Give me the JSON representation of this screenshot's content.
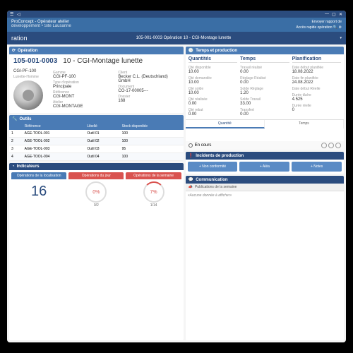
{
  "app": {
    "name": "ProConcept - Opérateur atelier",
    "context": "développement • Site Lausanne",
    "report": "Envoyer rapport de",
    "quick": "Accès rapide opération"
  },
  "page": {
    "title": "ration",
    "breadcrumb": "105-001-0003 Opération 10 - CGI-Montage lunette"
  },
  "operation": {
    "panel_title": "Opération",
    "number": "105-001-0003",
    "name": "10 - CGI-Montage lunette",
    "product_code": "CGI-PF-100",
    "product_name": "Lunette-Homme",
    "gamme_lbl": "Gamme",
    "gamme": "CGI-PF-100",
    "type_lbl": "Type d'opération",
    "type": "Principale",
    "ref_lbl": "Référence",
    "ref": "CGI-MONT",
    "atelier_lbl": "Atelier",
    "atelier": "CGI-MONTAGE",
    "client_lbl": "Client",
    "client": "Becker C.L. (Deutschland) GmbH",
    "doc_lbl": "Document",
    "doc": "CO-17-00005---",
    "dossier_lbl": "Dossier",
    "dossier": "168"
  },
  "qp": {
    "panel_title": "Temps et production",
    "cols": [
      "Quantités",
      "Temps",
      "Planification"
    ],
    "quantities": [
      {
        "l": "Qté disponible",
        "v": "10.00"
      },
      {
        "l": "Qté demandée",
        "v": "10.00"
      },
      {
        "l": "Qté solde",
        "v": "10.00"
      },
      {
        "l": "Qté réalisée",
        "v": "0.00"
      },
      {
        "l": "Qté rebut",
        "v": "0.00"
      }
    ],
    "temps": [
      {
        "l": "Travail réalisé",
        "v": "0.00"
      },
      {
        "l": "Réglage Réalisé",
        "v": "0.00"
      },
      {
        "l": "Solde Réglage",
        "v": "1.20"
      },
      {
        "l": "Solde Travail",
        "v": "33.00"
      },
      {
        "l": "Transfert",
        "v": "0.00"
      }
    ],
    "planif": [
      {
        "l": "Date début planifiée",
        "v": "18.08.2022"
      },
      {
        "l": "Date fin planifiée",
        "v": "24.08.2022"
      },
      {
        "l": "Date début Réelle",
        "v": ""
      },
      {
        "l": "Durée tâche",
        "v": "4.525"
      },
      {
        "l": "Durée réelle",
        "v": "0"
      }
    ],
    "tabs": [
      "Quantité",
      "Temps"
    ],
    "status": "En cours"
  },
  "tools": {
    "panel_title": "Outils",
    "headers": [
      "",
      "Référence",
      "Libellé",
      "Stock disponible"
    ],
    "rows": [
      {
        "n": "1",
        "ref": "AGE-TOOL-001",
        "lib": "Outil 01",
        "stock": "100"
      },
      {
        "n": "2",
        "ref": "AGE-TOOL-002",
        "lib": "Outil 02",
        "stock": "100"
      },
      {
        "n": "3",
        "ref": "AGE-TOOL-003",
        "lib": "Outil 03",
        "stock": "95"
      },
      {
        "n": "4",
        "ref": "AGE-TOOL-004",
        "lib": "Outil 04",
        "stock": "100"
      }
    ]
  },
  "incidents": {
    "panel_title": "Incidents de production",
    "btns": [
      "Non conformité",
      "Aléa",
      "Notes"
    ]
  },
  "indicators": {
    "panel_title": "Indicateurs",
    "cards": [
      {
        "h": "Opérations de la localisation",
        "big": "16"
      },
      {
        "h": "Opérations du jour",
        "pct": "0%",
        "sub": "0/2"
      },
      {
        "h": "Opérations de la semaine",
        "pct": "7%",
        "sub": "1/14"
      }
    ]
  },
  "comm": {
    "panel_title": "Communication",
    "sub": "Publications de la semaine",
    "empty": "«Aucune donnée à afficher»"
  }
}
